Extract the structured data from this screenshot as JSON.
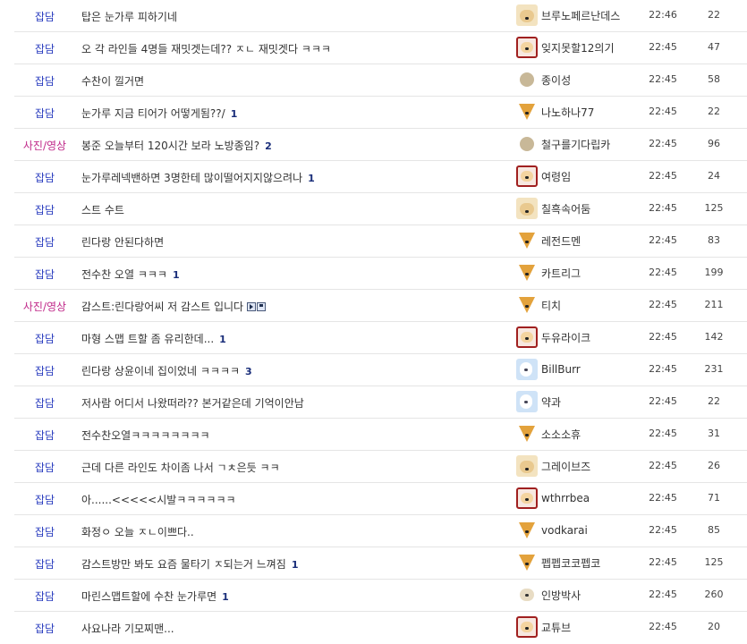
{
  "rows": [
    {
      "category": "잡담",
      "title": "탑은 눈가루 피하기네",
      "comments": "",
      "media": false,
      "author": "브루노페르난데스",
      "avatar": "dog",
      "time": "22:46",
      "views": "22"
    },
    {
      "category": "잡담",
      "title": "오 각 라인들 4명들 재밋겟는데?? ㅈㄴ 재밋겟다 ㅋㅋㅋ",
      "comments": "",
      "media": false,
      "author": "잊지못할12의기",
      "avatar": "red",
      "time": "22:45",
      "views": "47"
    },
    {
      "category": "잡담",
      "title": "수찬이 낄거면",
      "comments": "",
      "media": false,
      "author": "종이성",
      "avatar": "dot",
      "time": "22:45",
      "views": "58"
    },
    {
      "category": "잡담",
      "title": "눈가루 지금 티어가 어떻게됨??/",
      "comments": "1",
      "media": false,
      "author": "나노하나77",
      "avatar": "fox",
      "time": "22:45",
      "views": "22"
    },
    {
      "category": "사진/영상",
      "title": "봉준 오늘부터 120시간 보라 노방종임?",
      "comments": "2",
      "media": false,
      "author": "철구를기다립카",
      "avatar": "dot",
      "time": "22:45",
      "views": "96"
    },
    {
      "category": "잡담",
      "title": "눈가루레넥밴하면 3명한테 많이떨어지지않으려나",
      "comments": "1",
      "media": false,
      "author": "여령임",
      "avatar": "red",
      "time": "22:45",
      "views": "24"
    },
    {
      "category": "잡담",
      "title": "스트 수트",
      "comments": "",
      "media": false,
      "author": "칠흑속어둠",
      "avatar": "dog",
      "time": "22:45",
      "views": "125"
    },
    {
      "category": "잡담",
      "title": "린다랑 안된다하면",
      "comments": "",
      "media": false,
      "author": "레전드멘",
      "avatar": "fox",
      "time": "22:45",
      "views": "83"
    },
    {
      "category": "잡담",
      "title": "전수찬 오열 ㅋㅋㅋ",
      "comments": "1",
      "media": false,
      "author": "카트리그",
      "avatar": "fox",
      "time": "22:45",
      "views": "199"
    },
    {
      "category": "사진/영상",
      "title": "감스트:린다랑어씨 저 감스트 입니다",
      "comments": "",
      "media": true,
      "author": "티치",
      "avatar": "fox",
      "time": "22:45",
      "views": "211"
    },
    {
      "category": "잡담",
      "title": "마형 스맵 트할 좀 유리한데...",
      "comments": "1",
      "media": false,
      "author": "두유라이크",
      "avatar": "red",
      "time": "22:45",
      "views": "142"
    },
    {
      "category": "잡담",
      "title": "린다랑 상윤이네 집이었네 ㅋㅋㅋㅋ",
      "comments": "3",
      "media": false,
      "author": "BillBurr",
      "avatar": "blue",
      "time": "22:45",
      "views": "231"
    },
    {
      "category": "잡담",
      "title": "저사람 어디서 나왔떠라?? 본거같은데 기억이안남",
      "comments": "",
      "media": false,
      "author": "약과",
      "avatar": "blue",
      "time": "22:45",
      "views": "22"
    },
    {
      "category": "잡담",
      "title": "전수찬오열ㅋㅋㅋㅋㅋㅋㅋㅋ",
      "comments": "",
      "media": false,
      "author": "소소소휴",
      "avatar": "fox",
      "time": "22:45",
      "views": "31"
    },
    {
      "category": "잡담",
      "title": "근데 다른 라인도 차이좀 나서 ㄱㅊ은듯 ㅋㅋ",
      "comments": "",
      "media": false,
      "author": "그레이브즈",
      "avatar": "dog",
      "time": "22:45",
      "views": "26"
    },
    {
      "category": "잡담",
      "title": "아......<<<<<시발ㅋㅋㅋㅋㅋㅋ",
      "comments": "",
      "media": false,
      "author": "wthrrbea",
      "avatar": "red",
      "time": "22:45",
      "views": "71"
    },
    {
      "category": "잡담",
      "title": "화정ㅇ 오늘 ㅈㄴ이쁘다..",
      "comments": "",
      "media": false,
      "author": "vodkarai",
      "avatar": "fox",
      "time": "22:45",
      "views": "85"
    },
    {
      "category": "잡담",
      "title": "감스트방만 봐도 요즘 물타기 ㅈ되는거 느껴짐",
      "comments": "1",
      "media": false,
      "author": "펩펩코코펩코",
      "avatar": "fox",
      "time": "22:45",
      "views": "125"
    },
    {
      "category": "잡담",
      "title": "마린스맵트할에 수찬 눈가루면",
      "comments": "1",
      "media": false,
      "author": "인방박사",
      "avatar": "pup",
      "time": "22:45",
      "views": "260"
    },
    {
      "category": "잡담",
      "title": "사요나라 기모찌맨...",
      "comments": "",
      "media": false,
      "author": "교튜브",
      "avatar": "red",
      "time": "22:45",
      "views": "20"
    }
  ],
  "colors": {
    "category": "#2a3dbf",
    "category_photo": "#c02a8a",
    "comment_count": "#1a2e7a",
    "divider": "#e5e5e5"
  },
  "icons": {
    "media": [
      "play-icon",
      "disk-icon"
    ]
  }
}
